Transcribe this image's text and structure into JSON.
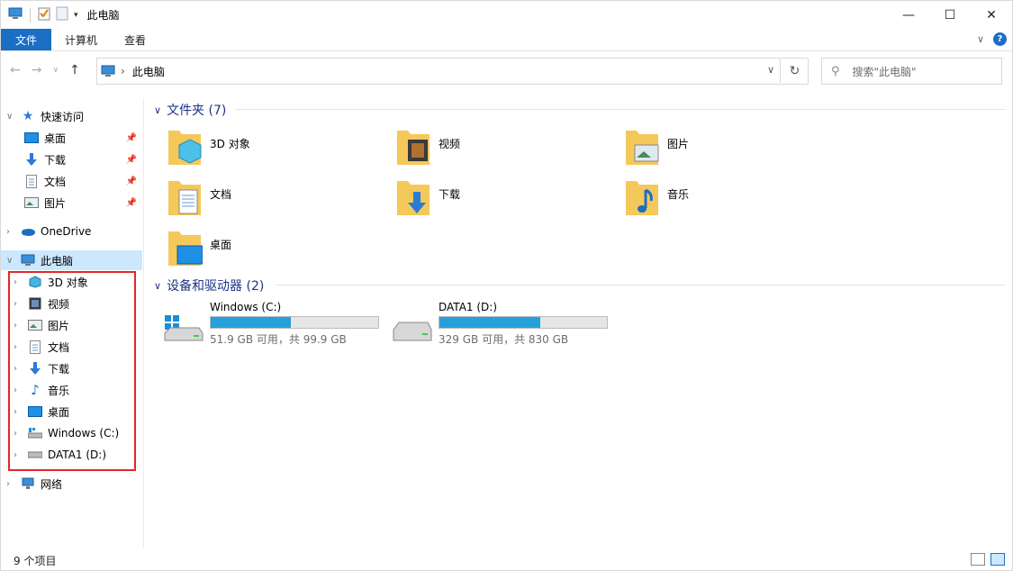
{
  "title": "此电脑",
  "ribbon": {
    "tabs": [
      "文件",
      "计算机",
      "查看"
    ]
  },
  "address": {
    "crumb": "此电脑"
  },
  "search": {
    "placeholder": "搜索\"此电脑\""
  },
  "navpane": {
    "quick_access": "快速访问",
    "quick_items": [
      "桌面",
      "下载",
      "文档",
      "图片"
    ],
    "onedrive": "OneDrive",
    "this_pc": "此电脑",
    "pc_items": [
      "3D 对象",
      "视频",
      "图片",
      "文档",
      "下载",
      "音乐",
      "桌面",
      "Windows (C:)",
      "DATA1 (D:)"
    ],
    "network": "网络"
  },
  "content": {
    "folders_header": "文件夹 (7)",
    "folders": [
      "3D 对象",
      "视频",
      "图片",
      "文档",
      "下载",
      "音乐",
      "桌面"
    ],
    "drives_header": "设备和驱动器 (2)",
    "drives": [
      {
        "name": "Windows (C:)",
        "info": "51.9 GB 可用，共 99.9 GB",
        "used_fraction": 0.48
      },
      {
        "name": "DATA1 (D:)",
        "info": "329 GB 可用，共 830 GB",
        "used_fraction": 0.6
      }
    ]
  },
  "status": {
    "count": "9 个项目"
  },
  "colors": {
    "accent": "#1a6fc4",
    "selection": "#cce8ff",
    "highlight_box": "#e2262c",
    "drive_bar": "#26a0da",
    "group_header": "#1e3287"
  }
}
